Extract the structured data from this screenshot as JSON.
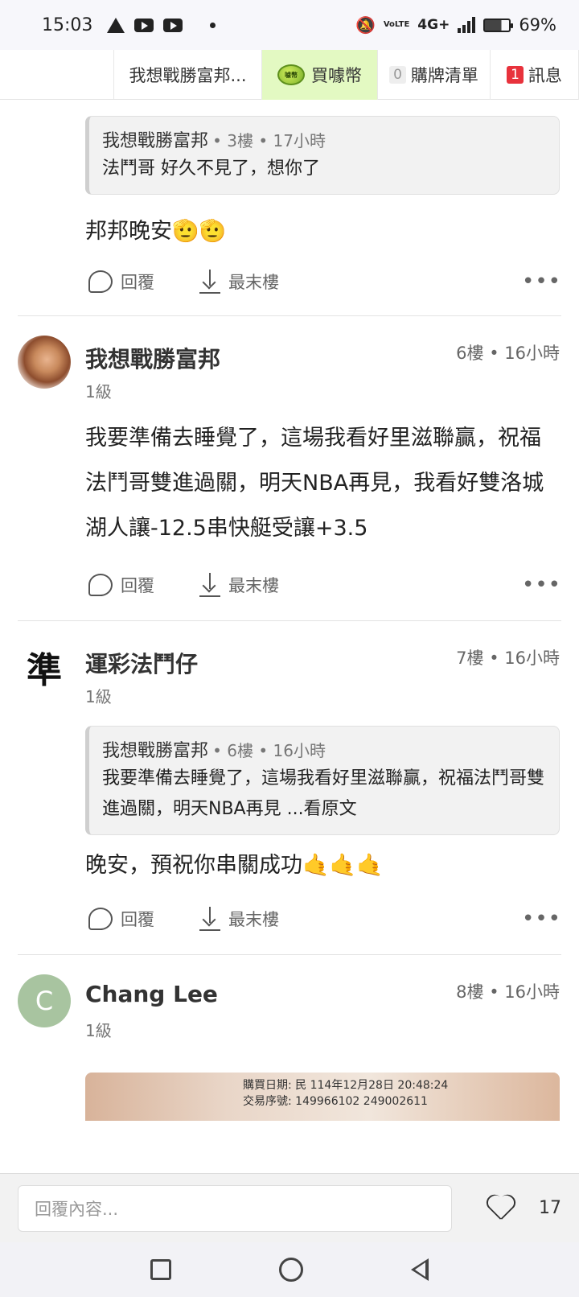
{
  "status_bar": {
    "time": "15:03",
    "network": "4G+",
    "battery": "69%",
    "volte": "VoLTE",
    "battery_level": 0.69
  },
  "top_tabs": {
    "thread_title": "我想戰勝富邦...",
    "buy_label": "買噱幣",
    "coin_text": "噱幣",
    "cart_count": "0",
    "cart_label": "購牌清單",
    "msg_count": "1",
    "msg_label": "訊息"
  },
  "actions": {
    "reply": "回覆",
    "last_floor": "最末樓",
    "more": "•••"
  },
  "posts": [
    {
      "quote": {
        "author": "我想戰勝富邦",
        "meta": "• 3樓 • 17小時",
        "text": "法鬥哥 好久不見了，想你了"
      },
      "body": "邦邦晚安🫡🫡"
    },
    {
      "author": "我想戰勝富邦",
      "level": "1級",
      "meta": "6樓 • 16小時",
      "body": "我要準備去睡覺了，這場我看好里滋聯贏，祝福法鬥哥雙進過關，明天NBA再見，我看好雙洛城湖人讓-12.5串快艇受讓+3.5"
    },
    {
      "author": "運彩法鬥仔",
      "avatar_char": "準",
      "level": "1級",
      "meta": "7樓 • 16小時",
      "quote": {
        "author": "我想戰勝富邦",
        "meta": "• 6樓 • 16小時",
        "text": "我要準備去睡覺了，這場我看好里滋聯贏，祝福法鬥哥雙進過關，明天NBA再見 ...看原文"
      },
      "body": "晚安，預祝你串關成功🤙🤙🤙"
    },
    {
      "author": "Chang Lee",
      "avatar_letter": "C",
      "level": "1級",
      "meta": "8樓 • 16小時",
      "image_text_1": "購買日期: 民 114年12月28日 20:48:24",
      "image_text_2": "交易序號: 149966102 249002611"
    }
  ],
  "input_bar": {
    "placeholder": "回覆內容...",
    "like_count": "17"
  }
}
